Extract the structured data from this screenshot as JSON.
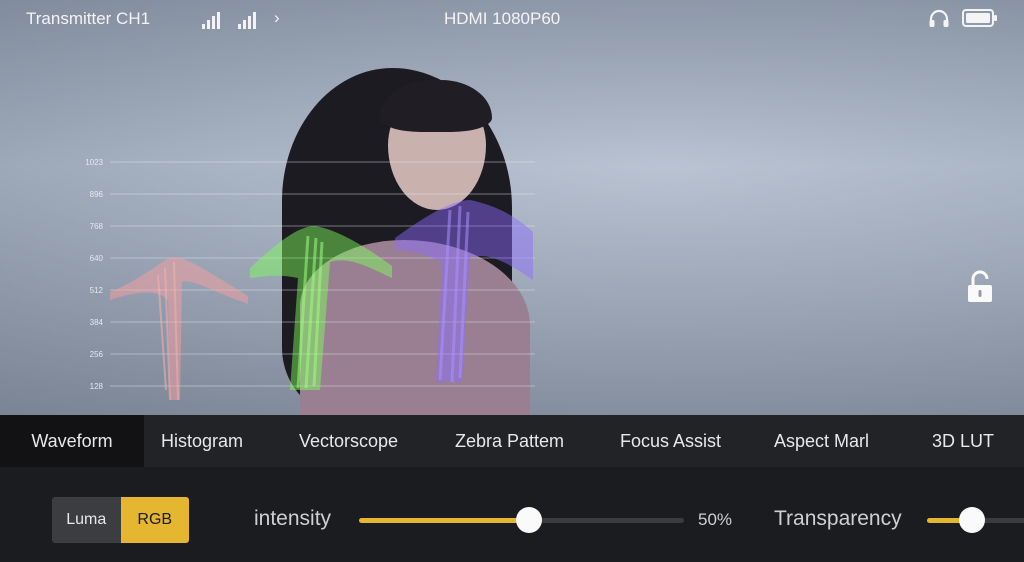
{
  "status": {
    "transmitter": "Transmitter CH1",
    "signal_format": "HDMI 1080P60",
    "icons": [
      "signal-bars-icon",
      "signal-bars-icon",
      "chevron-right-icon",
      "headphones-icon",
      "battery-icon",
      "unlock-icon"
    ]
  },
  "waveform": {
    "ticks": [
      "1023",
      "896",
      "768",
      "640",
      "512",
      "384",
      "256",
      "128"
    ],
    "channel_colors": {
      "red": "#ff9b9b",
      "green": "#7dff5a",
      "blue": "#8c6bff"
    }
  },
  "tabs": [
    "Waveform",
    "Histogram",
    "Vectorscope",
    "Zebra Pattem",
    "Focus Assist",
    "Aspect Marl",
    "3D LUT"
  ],
  "active_tab": "Waveform",
  "mode": {
    "options": [
      "Luma",
      "RGB"
    ],
    "selected": "RGB"
  },
  "intensity": {
    "label": "intensity",
    "value": 50,
    "value_text": "50%"
  },
  "transparency": {
    "label": "Transparency",
    "value": 0.45
  },
  "colors": {
    "accent": "#e5b62f",
    "panel": "#222326",
    "active_tab": "#121214"
  }
}
